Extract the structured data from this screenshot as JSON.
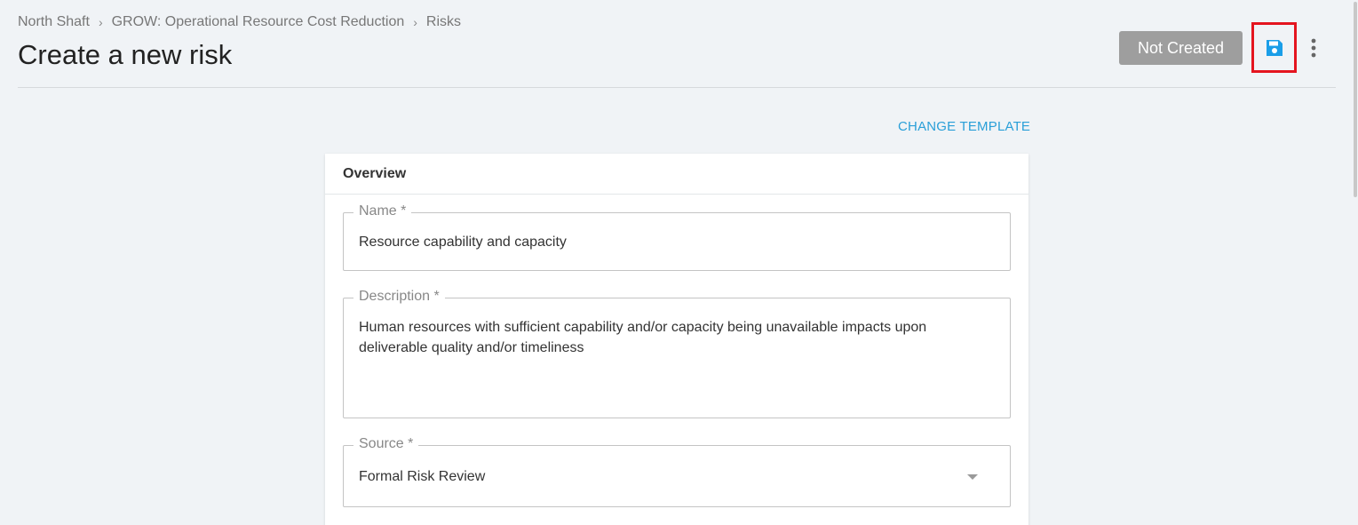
{
  "breadcrumb": {
    "items": [
      "North Shaft",
      "GROW: Operational Resource Cost Reduction",
      "Risks"
    ],
    "separator": "›"
  },
  "page_title": "Create a new risk",
  "toolbar": {
    "status_label": "Not Created",
    "save_icon": "floppy-disk-icon",
    "more_icon": "vertical-ellipsis-icon"
  },
  "change_template_label": "CHANGE TEMPLATE",
  "overview": {
    "title": "Overview",
    "name": {
      "label": "Name *",
      "value": "Resource capability and capacity"
    },
    "description": {
      "label": "Description *",
      "value": "Human resources with sufficient capability and/or capacity being unavailable impacts upon deliverable quality and/or timeliness"
    },
    "source": {
      "label": "Source *",
      "value": "Formal Risk Review"
    }
  },
  "colors": {
    "accent": "#2a9fd8",
    "save_icon": "#1a9ee8",
    "highlight_border": "#e4151f",
    "status_bg": "#9e9e9e",
    "page_bg": "#f0f3f6"
  }
}
